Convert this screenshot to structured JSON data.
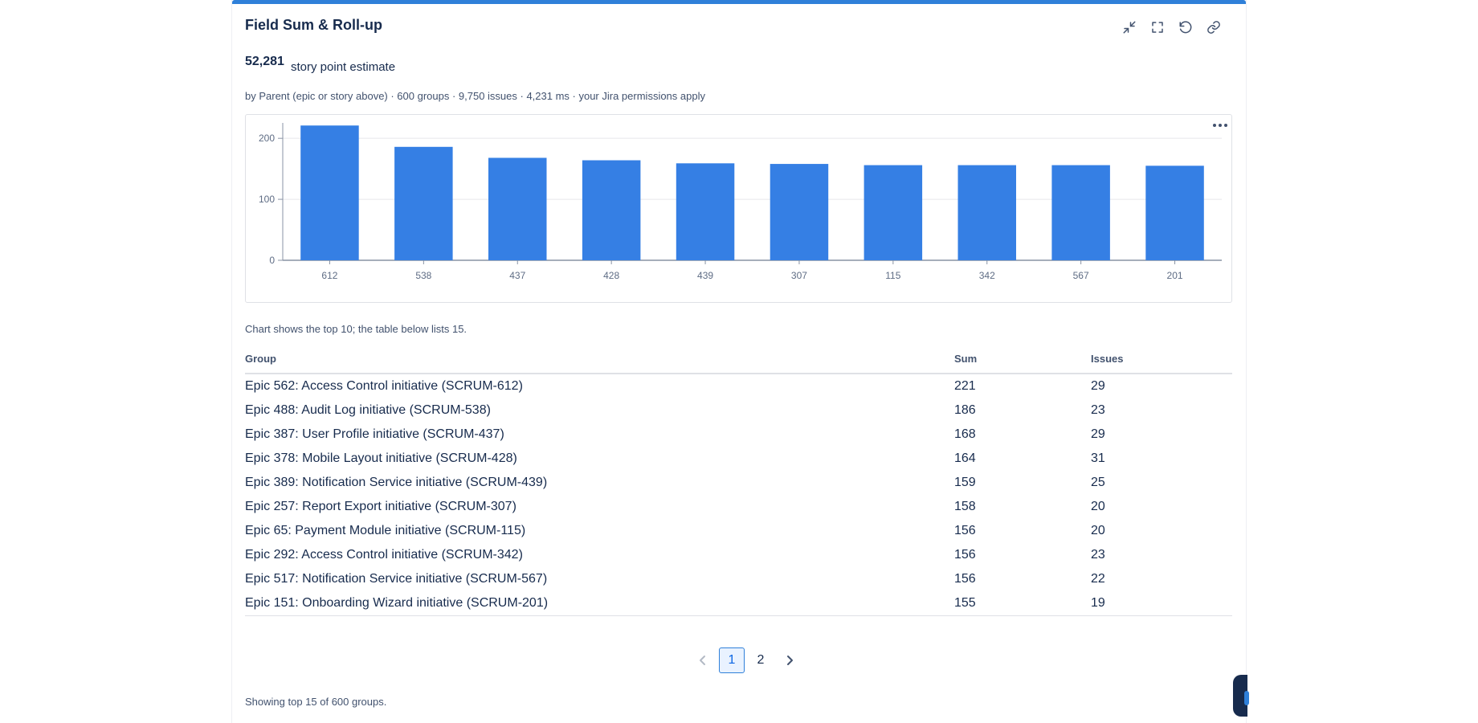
{
  "panel": {
    "title": "Field Sum & Roll-up",
    "actions": [
      {
        "name": "collapse-icon"
      },
      {
        "name": "fullscreen-icon"
      },
      {
        "name": "refresh-icon"
      },
      {
        "name": "link-icon"
      }
    ]
  },
  "summary": {
    "total": "52,281",
    "label": "story point estimate",
    "meta": "by Parent (epic or story above) · 600 groups · 9,750 issues · 4,231 ms · your Jira permissions apply"
  },
  "chart_data": {
    "type": "bar",
    "categories": [
      "612",
      "538",
      "437",
      "428",
      "439",
      "307",
      "115",
      "342",
      "567",
      "201"
    ],
    "values": [
      221,
      186,
      168,
      164,
      159,
      158,
      156,
      156,
      156,
      155
    ],
    "ylim": [
      0,
      220
    ],
    "yticks": [
      0,
      100,
      200
    ],
    "grid": true,
    "color": "#357fe4"
  },
  "chart_menu_icon": "more-horizontal-icon",
  "note": "Chart shows the top 10; the table below lists 15.",
  "table": {
    "headers": [
      "Group",
      "Sum",
      "Issues"
    ],
    "rows": [
      [
        "Epic 562: Access Control initiative (SCRUM-612)",
        "221",
        "29"
      ],
      [
        "Epic 488: Audit Log initiative (SCRUM-538)",
        "186",
        "23"
      ],
      [
        "Epic 387: User Profile initiative (SCRUM-437)",
        "168",
        "29"
      ],
      [
        "Epic 378: Mobile Layout initiative (SCRUM-428)",
        "164",
        "31"
      ],
      [
        "Epic 389: Notification Service initiative (SCRUM-439)",
        "159",
        "25"
      ],
      [
        "Epic 257: Report Export initiative (SCRUM-307)",
        "158",
        "20"
      ],
      [
        "Epic 65: Payment Module initiative (SCRUM-115)",
        "156",
        "20"
      ],
      [
        "Epic 292: Access Control initiative (SCRUM-342)",
        "156",
        "23"
      ],
      [
        "Epic 517: Notification Service initiative (SCRUM-567)",
        "156",
        "22"
      ],
      [
        "Epic 151: Onboarding Wizard initiative (SCRUM-201)",
        "155",
        "19"
      ]
    ]
  },
  "pagination": {
    "pages": [
      "1",
      "2"
    ],
    "current": "1"
  },
  "footer": "Showing top 15 of 600 groups.",
  "colors": {
    "accent": "#2f80d9",
    "bar": "#357fe4"
  }
}
